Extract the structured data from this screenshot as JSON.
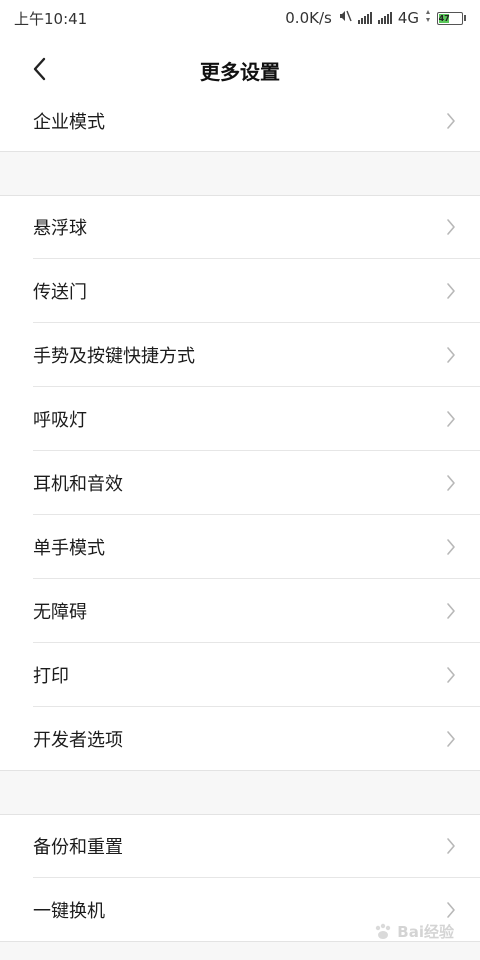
{
  "status_bar": {
    "time": "上午10:41",
    "network_speed": "0.0K/s",
    "network_type": "4G",
    "battery": "47",
    "battery_level": 0.47,
    "icons": [
      "mute-icon",
      "signal-icon",
      "signal-icon",
      "battery-icon"
    ]
  },
  "header": {
    "title": "更多设置",
    "back_icon": "chevron-left-icon"
  },
  "groups": [
    {
      "items": [
        {
          "label": "企业模式"
        }
      ]
    },
    {
      "items": [
        {
          "label": "悬浮球"
        },
        {
          "label": "传送门"
        },
        {
          "label": "手势及按键快捷方式"
        },
        {
          "label": "呼吸灯"
        },
        {
          "label": "耳机和音效"
        },
        {
          "label": "单手模式"
        },
        {
          "label": "无障碍"
        },
        {
          "label": "打印"
        },
        {
          "label": "开发者选项"
        }
      ]
    },
    {
      "items": [
        {
          "label": "备份和重置"
        },
        {
          "label": "一键换机"
        }
      ]
    }
  ],
  "watermark": {
    "text": "Bai经验"
  },
  "colors": {
    "background": "#f7f7f7",
    "row": "#ffffff",
    "divider": "#e6e6e6",
    "chevron": "#b8b8b8",
    "battery_fill": "#5ac85a"
  }
}
